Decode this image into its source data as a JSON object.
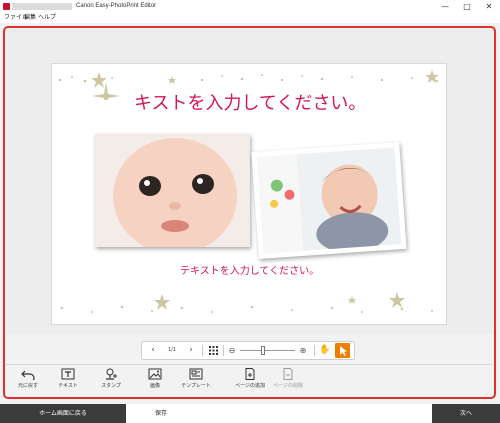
{
  "window": {
    "title": "Canon Easy-PhotoPrint Editor",
    "minimize_icon": "minimize-icon",
    "maximize_icon": "maximize-icon",
    "close_icon": "close-icon"
  },
  "menu": [
    "ファイル",
    "編集",
    "ヘルプ"
  ],
  "page": {
    "title_text": "キストを入力してください。",
    "sub_text": "テキストを入力してください。",
    "accent_color": "#d4145a",
    "decoration_color": "#cdc6a4"
  },
  "pagebar": {
    "counter": "1/1",
    "prev_icon": "chevron-left-icon",
    "next_icon": "chevron-right-icon",
    "grid_icon": "grid-icon",
    "zoom_out_icon": "zoom-out-icon",
    "zoom_in_icon": "zoom-in-icon",
    "hand_icon": "hand-icon",
    "select_icon": "cursor-icon",
    "zoom_level": 0.42,
    "select_color": "#f07c00"
  },
  "tools": [
    {
      "label": "元に戻す",
      "icon": "undo-icon",
      "enabled": true
    },
    {
      "label": "テキスト",
      "icon": "text-icon",
      "enabled": true
    },
    {
      "label": "スタンプ",
      "icon": "stamp-icon",
      "enabled": true
    },
    {
      "label": "画像",
      "icon": "image-icon",
      "enabled": true
    },
    {
      "label": "テンプレート",
      "icon": "template-icon",
      "enabled": true
    },
    {
      "label": "ページの追加",
      "icon": "add-page-icon",
      "enabled": true
    },
    {
      "label": "ページの削除",
      "icon": "delete-page-icon",
      "enabled": false
    }
  ],
  "bottom": {
    "home_label": "ホーム画面に戻る",
    "save_label": "保存",
    "next_label": "次へ"
  },
  "frame_color": "#e03131"
}
